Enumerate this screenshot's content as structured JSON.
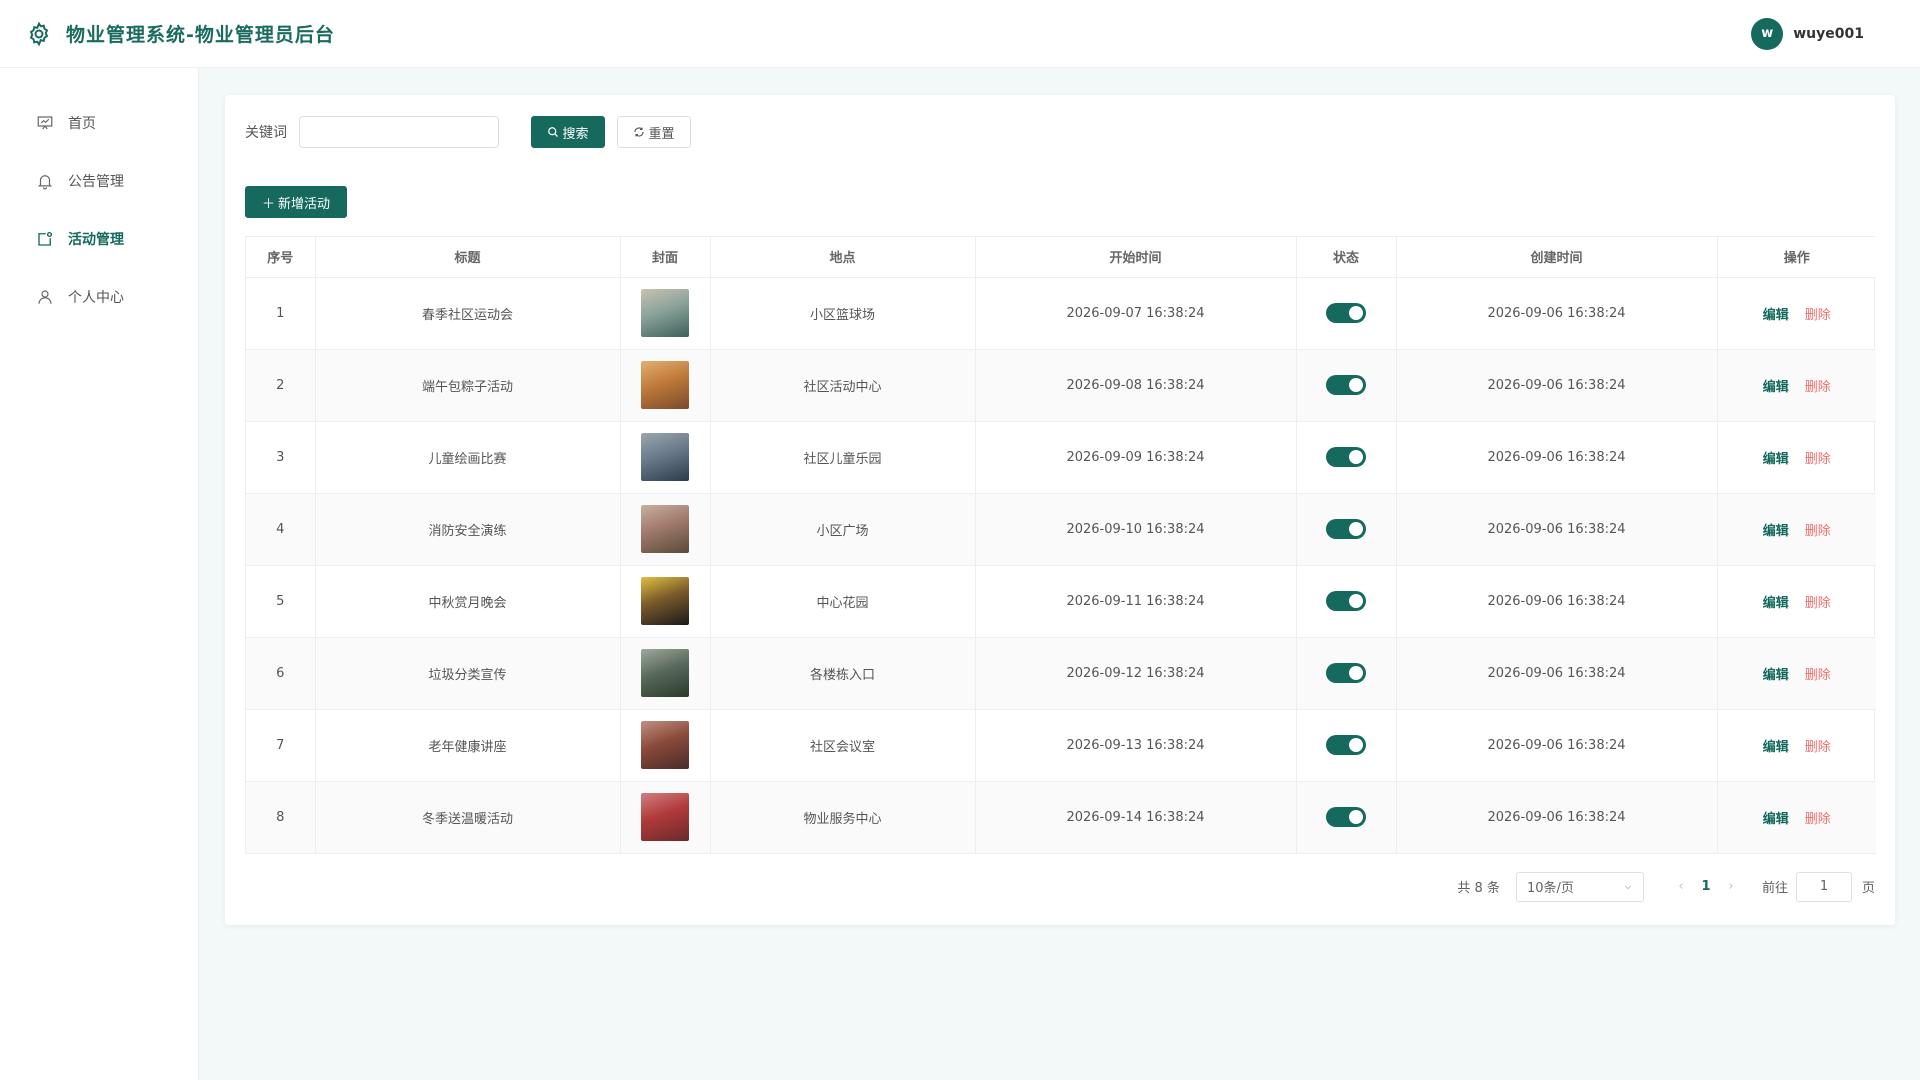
{
  "header": {
    "title": "物业管理系统-物业管理员后台",
    "avatar_letter": "w",
    "username": "wuye001"
  },
  "sidebar": {
    "items": [
      {
        "label": "首页",
        "icon": "presentation-board-icon"
      },
      {
        "label": "公告管理",
        "icon": "bell-icon"
      },
      {
        "label": "活动管理",
        "icon": "activity-calendar-icon",
        "active": true
      },
      {
        "label": "个人中心",
        "icon": "user-icon"
      }
    ]
  },
  "search": {
    "label": "关键词",
    "value": "",
    "placeholder": "",
    "search_button": "搜索",
    "reset_button": "重置"
  },
  "toolbar": {
    "add_button": "新增活动"
  },
  "table": {
    "columns": [
      "序号",
      "标题",
      "封面",
      "地点",
      "开始时间",
      "状态",
      "创建时间",
      "操作"
    ],
    "edit_label": "编辑",
    "delete_label": "删除",
    "rows": [
      {
        "index": "1",
        "title": "春季社区运动会",
        "location": "小区篮球场",
        "start": "2026-09-07 16:38:24",
        "status": true,
        "created": "2026-09-06 16:38:24"
      },
      {
        "index": "2",
        "title": "端午包粽子活动",
        "location": "社区活动中心",
        "start": "2026-09-08 16:38:24",
        "status": true,
        "created": "2026-09-06 16:38:24"
      },
      {
        "index": "3",
        "title": "儿童绘画比赛",
        "location": "社区儿童乐园",
        "start": "2026-09-09 16:38:24",
        "status": true,
        "created": "2026-09-06 16:38:24"
      },
      {
        "index": "4",
        "title": "消防安全演练",
        "location": "小区广场",
        "start": "2026-09-10 16:38:24",
        "status": true,
        "created": "2026-09-06 16:38:24"
      },
      {
        "index": "5",
        "title": "中秋赏月晚会",
        "location": "中心花园",
        "start": "2026-09-11 16:38:24",
        "status": true,
        "created": "2026-09-06 16:38:24"
      },
      {
        "index": "6",
        "title": "垃圾分类宣传",
        "location": "各楼栋入口",
        "start": "2026-09-12 16:38:24",
        "status": true,
        "created": "2026-09-06 16:38:24"
      },
      {
        "index": "7",
        "title": "老年健康讲座",
        "location": "社区会议室",
        "start": "2026-09-13 16:38:24",
        "status": true,
        "created": "2026-09-06 16:38:24"
      },
      {
        "index": "8",
        "title": "冬季送温暖活动",
        "location": "物业服务中心",
        "start": "2026-09-14 16:38:24",
        "status": true,
        "created": "2026-09-06 16:38:24"
      }
    ]
  },
  "pagination": {
    "total": "共 8 条",
    "page_size": "10条/页",
    "current": "1",
    "goto_label": "前往",
    "goto_value": "1",
    "page_suffix": "页"
  },
  "colors": {
    "accent": "#15695d",
    "danger": "#f56c6c",
    "background": "#f2f9f8"
  }
}
